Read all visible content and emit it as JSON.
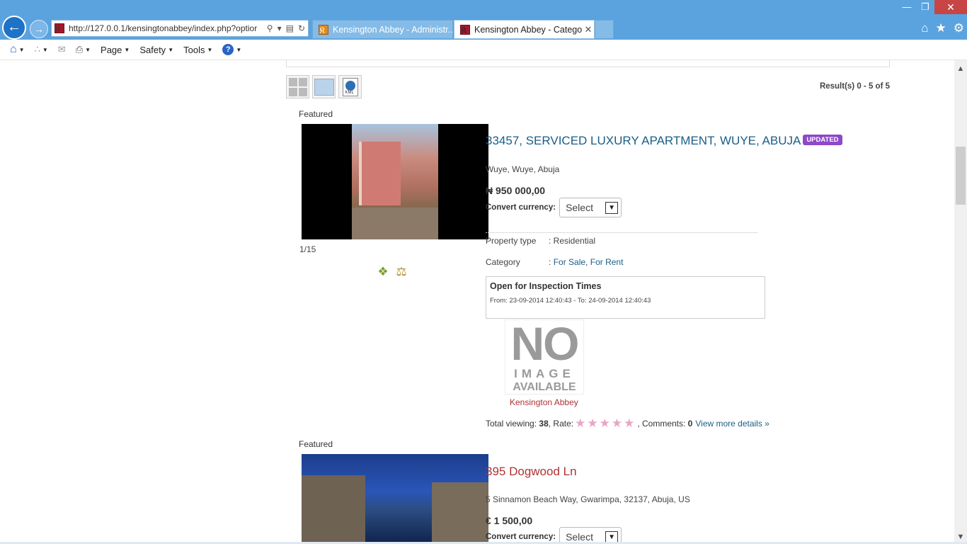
{
  "browser": {
    "address": "http://127.0.0.1/kensingtonabbey/index.php?optior",
    "tabs": [
      {
        "title": "Kensington Abbey - Administr..."
      },
      {
        "title": "Kensington Abbey - Catego..."
      }
    ],
    "commands": {
      "page": "Page",
      "safety": "Safety",
      "tools": "Tools"
    }
  },
  "listing": {
    "results": "Result(s) 0 - 5 of 5",
    "items": [
      {
        "featured": "Featured",
        "counter": "1/15",
        "title": "33457, SERVICED LUXURY APARTMENT, WUYE, ABUJA",
        "badge": "UPDATED",
        "address": "Wuye, Wuye, Abuja",
        "price": "₦ 950 000,00",
        "convert_label": "Convert currency:",
        "convert_value": "Select",
        "property_type_label": "Property type",
        "property_type_value": ": Residential",
        "category_label": "Category",
        "category_prefix": ":",
        "category_sale": "For Sale",
        "category_sep": ",",
        "category_rent": "For Rent",
        "inspection_title": "Open for Inspection Times",
        "inspection_time": "From: 23-09-2014 12:40:43 - To: 24-09-2014 12:40:43",
        "noimage_no": "NO",
        "noimage_image": "IMAGE",
        "noimage_available": "AVAILABLE",
        "agent": "Kensington Abbey",
        "views_label": "Total viewing:",
        "views": "38",
        "rate_label": ", Rate:",
        "comments_label": ", Comments:",
        "comments": "0",
        "details_link": "View more details »"
      },
      {
        "featured": "Featured",
        "title": "395 Dogwood Ln",
        "address": "5 Sinnamon Beach Way, Gwarimpa, 32137, Abuja, US",
        "price": "€ 1 500,00",
        "convert_label": "Convert currency:",
        "convert_value": "Select"
      }
    ]
  },
  "colors": {
    "chrome": "#5aa3df",
    "link": "#1a5e86",
    "red_link": "#b03234",
    "badge": "#8e48c8"
  }
}
